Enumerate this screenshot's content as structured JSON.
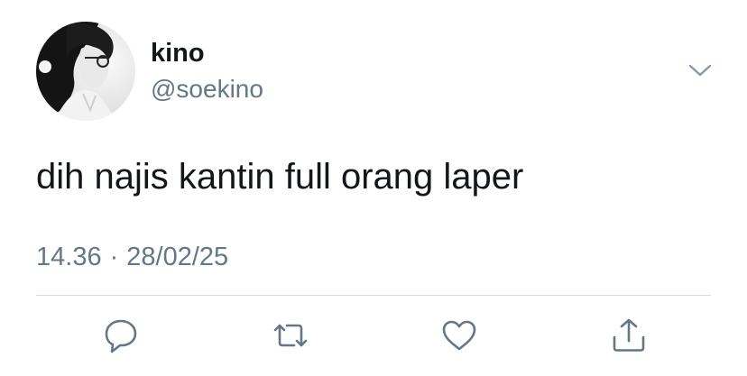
{
  "tweet": {
    "display_name": "kino",
    "handle": "@soekino",
    "text": "dih najis kantin full orang laper",
    "time": "14.36",
    "date": "28/02/25",
    "separator": "·"
  },
  "icons": {
    "more": "chevron-down-icon",
    "reply": "reply-icon",
    "retweet": "retweet-icon",
    "like": "heart-icon",
    "share": "share-icon"
  },
  "colors": {
    "text": "#14171a",
    "secondary": "#657786",
    "icon": "#657786",
    "divider": "#d6dbdf",
    "background": "#ffffff"
  }
}
